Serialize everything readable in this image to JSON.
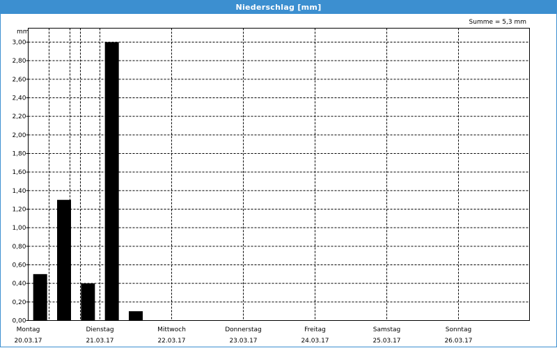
{
  "window": {
    "title": "Niederschlag [mm]"
  },
  "chart_data": {
    "type": "bar",
    "unit_label": "mm",
    "summary_text": "Summe = 5,3 mm",
    "ylim": [
      0,
      3.0
    ],
    "yticks": [
      "0,00",
      "0,20",
      "0,40",
      "0,60",
      "0,80",
      "1,00",
      "1,20",
      "1,40",
      "1,60",
      "1,80",
      "2,00",
      "2,20",
      "2,40",
      "2,60",
      "2,80",
      "3,00"
    ],
    "grid": true,
    "days": [
      {
        "day": "Montag",
        "date": "20.03.17"
      },
      {
        "day": "Dienstag",
        "date": "21.03.17"
      },
      {
        "day": "Mittwoch",
        "date": "22.03.17"
      },
      {
        "day": "Donnerstag",
        "date": "23.03.17"
      },
      {
        "day": "Freitag",
        "date": "24.03.17"
      },
      {
        "day": "Samstag",
        "date": "25.03.17"
      },
      {
        "day": "Sonntag",
        "date": "26.03.17"
      }
    ],
    "bars_per_day": 3,
    "values": [
      0.5,
      1.3,
      0.4,
      3.0,
      0.1,
      0,
      0,
      0,
      0,
      0,
      0,
      0,
      0,
      0,
      0,
      0,
      0,
      0,
      0,
      0,
      0
    ],
    "bar_color": "#000000",
    "accent_color": "#3c8fd0"
  }
}
